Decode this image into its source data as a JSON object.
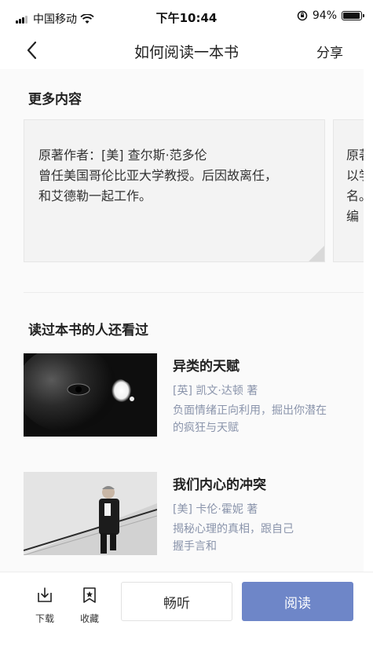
{
  "status_bar": {
    "carrier": "中国移动",
    "time": "下午10:44",
    "battery_percent": "94%",
    "battery_level": 0.94,
    "icons": [
      "signal-icon",
      "wifi-icon",
      "orientation-lock-icon",
      "battery-icon"
    ]
  },
  "nav": {
    "title": "如何阅读一本书",
    "share_label": "分享",
    "back_icon": "chevron-left-icon"
  },
  "more_content": {
    "title": "更多内容",
    "cards": [
      {
        "text": "原著作者：[美] 查尔斯·范多伦\n曾任美国哥伦比亚大学教授。后因故离任，\n和艾德勒一起工作。"
      },
      {
        "text": "原著\n以学\n名。\n编"
      }
    ]
  },
  "also_read": {
    "title": "读过本书的人还看过",
    "books": [
      {
        "title": "异类的天赋",
        "author": "[英] 凯文·达顿 著",
        "desc": "负面情绪正向利用，掘出你潜在\n的疯狂与天赋"
      },
      {
        "title": "我们内心的冲突",
        "author": "[美] 卡伦·霍妮 著",
        "desc": "揭秘心理的真相，跟自己\n握手言和"
      }
    ]
  },
  "bottom_bar": {
    "download_label": "下载",
    "favorite_label": "收藏",
    "listen_label": "畅听",
    "read_label": "阅读",
    "accent_color": "#6e86c8"
  }
}
